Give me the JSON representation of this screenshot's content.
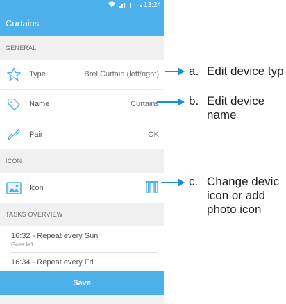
{
  "status_bar": {
    "time": "13:24",
    "wifi_icon": "wifi-icon",
    "signal_icon": "signal-icon",
    "battery_icon": "battery-icon"
  },
  "app_bar": {
    "title": "Curtains"
  },
  "sections": {
    "general": "GENERAL",
    "icon": "ICON",
    "tasks": "TASKS OVERVIEW"
  },
  "general_rows": [
    {
      "icon": "star-outline-icon",
      "label": "Type",
      "value": "Brel Curtain (left/right)"
    },
    {
      "icon": "tag-icon",
      "label": "Name",
      "value": "Curtains"
    },
    {
      "icon": "link-icon",
      "label": "Pair",
      "value": "OK"
    }
  ],
  "icon_row": {
    "icon": "image-icon",
    "label": "Icon",
    "value_icon": "curtain-icon"
  },
  "tasks": [
    {
      "title": "16:32 - Repeat every Sun",
      "subtitle": "Goes left"
    },
    {
      "title": "16:34 - Repeat every Fri",
      "subtitle": ""
    }
  ],
  "save_label": "Save",
  "annotations": [
    {
      "letter": "a.",
      "line1": "Edit device typ",
      "line2": ""
    },
    {
      "letter": "b.",
      "line1": "Edit device",
      "line2": "name"
    },
    {
      "letter": "c.",
      "line1": "Change devic",
      "line2": "icon or add",
      "line3": "photo icon"
    }
  ],
  "colors": {
    "primary": "#4cb1ea",
    "arrow": "#1a8ed8"
  }
}
